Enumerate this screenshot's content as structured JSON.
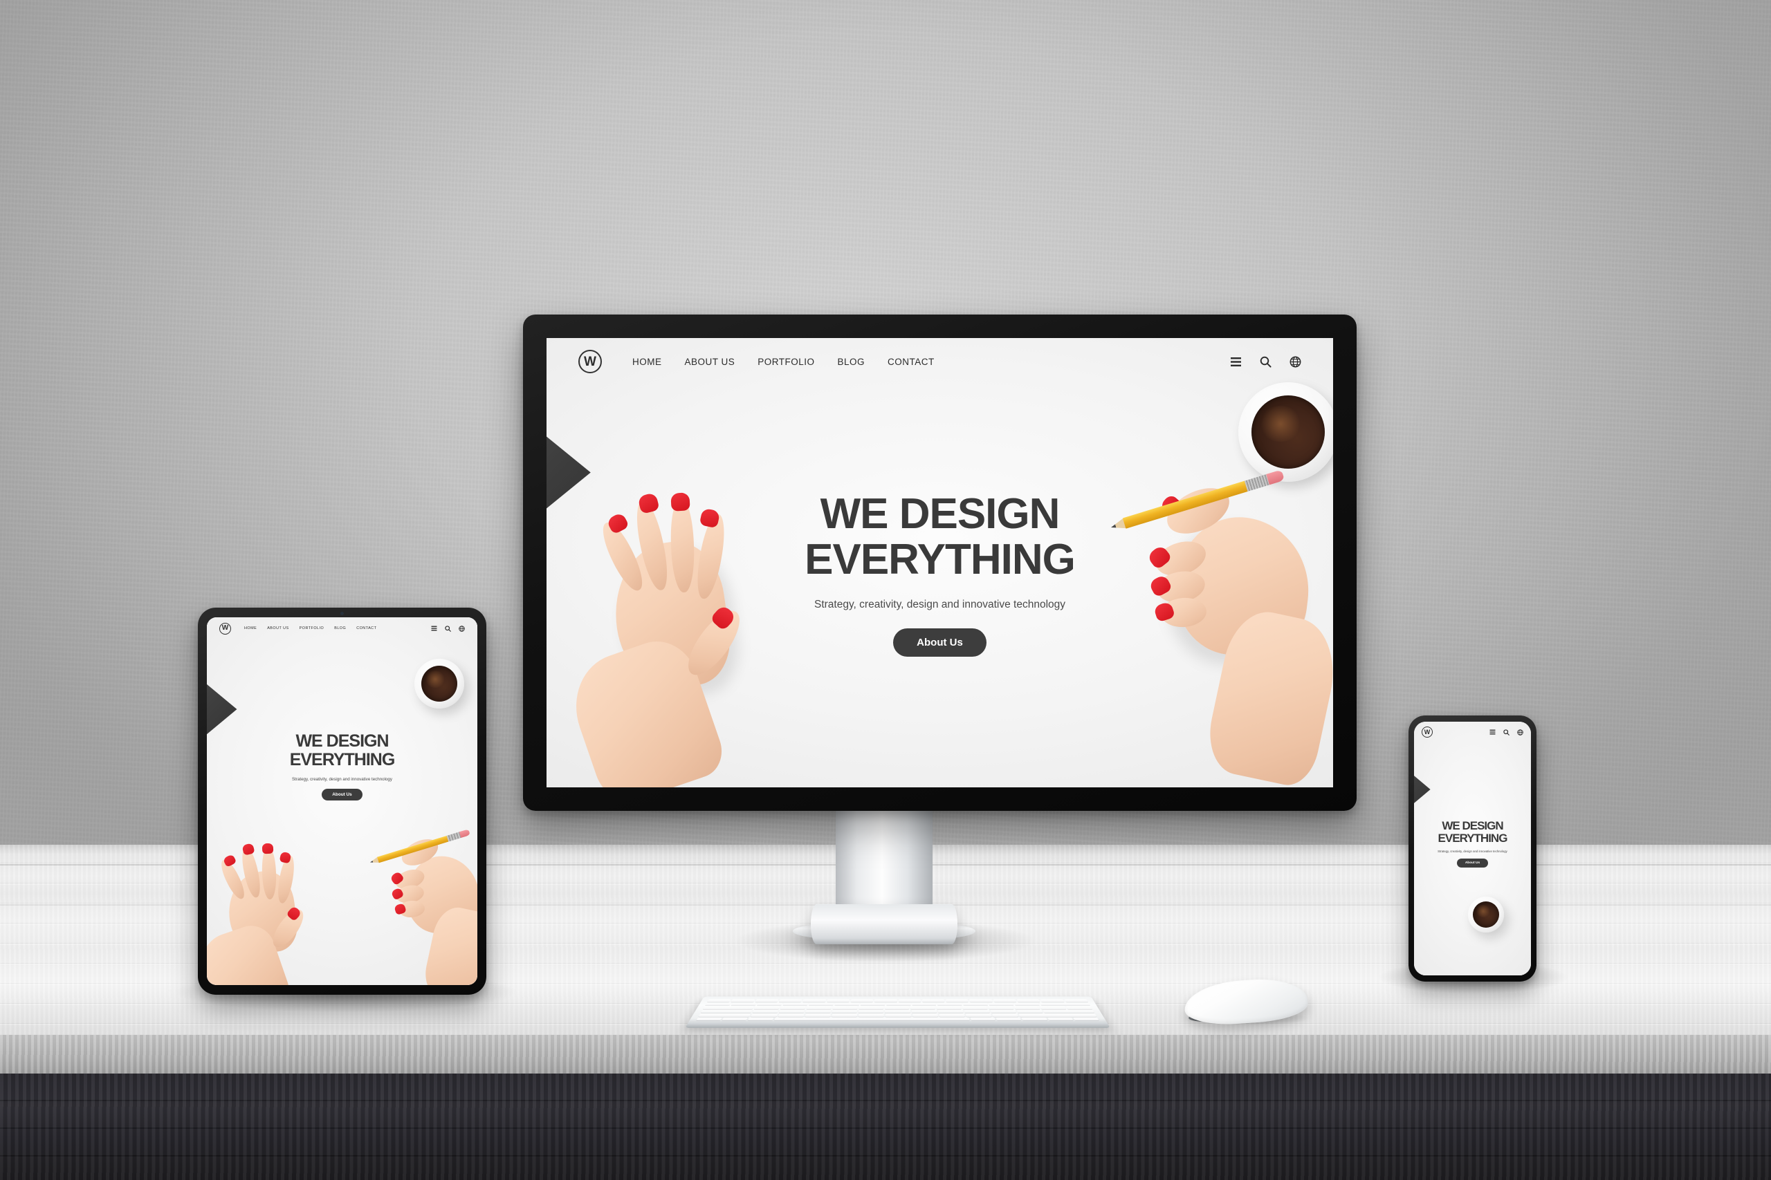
{
  "scene": {
    "description": "Responsive website mockup shown on desktop monitor, tablet and smartphone on a white wooden desk",
    "wall_color": "#c8c8c8",
    "desk_color": "#f0f0f0",
    "floor_color": "#24232a"
  },
  "site": {
    "brand": {
      "logo_letter": "W",
      "logo_name": "w-circle-logo"
    },
    "nav": [
      {
        "label": "HOME"
      },
      {
        "label": "ABOUT US"
      },
      {
        "label": "PORTFOLIO"
      },
      {
        "label": "BLOG"
      },
      {
        "label": "CONTACT"
      }
    ],
    "icons": [
      {
        "name": "hamburger-menu-icon"
      },
      {
        "name": "search-icon"
      },
      {
        "name": "globe-icon"
      }
    ],
    "hero": {
      "title_line1": "WE DESIGN",
      "title_line2": "EVERYTHING",
      "subtitle": "Strategy, creativity, design and innovative technology",
      "cta_label": "About Us",
      "title_color": "#3a3a3a",
      "cta_bg": "#3d3d3d",
      "cta_color": "#ffffff"
    },
    "photo_elements": {
      "coffee_cup": "coffee-cup-top-view",
      "left_hand": "left-hand-red-nails",
      "right_hand": "right-hand-holding-pencil",
      "pencil": "yellow-pencil",
      "dark_shape": "dark-notebook-corner",
      "nail_color": "#d5151f",
      "pencil_color": "#f0b323"
    }
  },
  "devices": {
    "monitor": {
      "name": "desktop-monitor",
      "bezel_color": "#111111"
    },
    "tablet": {
      "name": "tablet-device",
      "bezel_color": "#121212"
    },
    "phone": {
      "name": "smartphone-device",
      "bezel_color": "#141414"
    },
    "keyboard": {
      "name": "wireless-keyboard"
    },
    "mouse": {
      "name": "wireless-mouse"
    }
  }
}
